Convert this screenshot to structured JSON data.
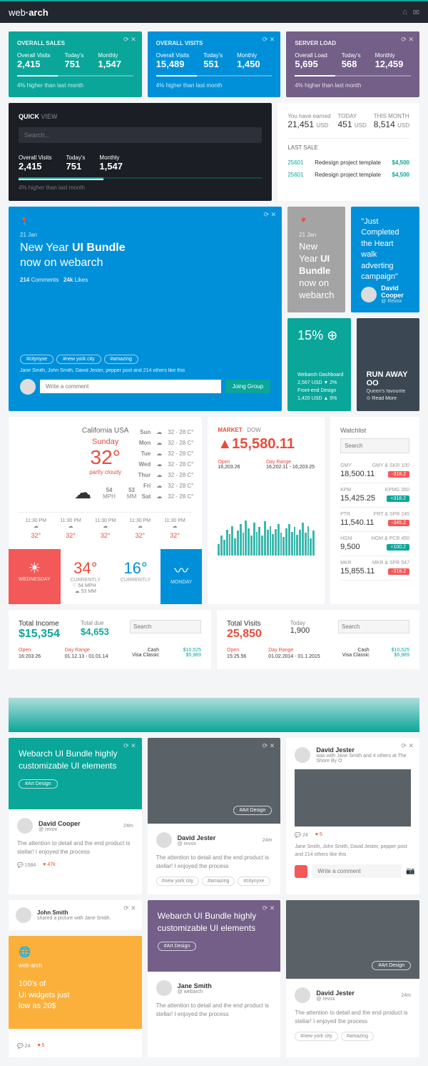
{
  "brand": {
    "pre": "web",
    "bold": "arch"
  },
  "stats": [
    {
      "title": "OVERALL SALES",
      "items": [
        {
          "l": "Overall Visits",
          "v": "2,415"
        },
        {
          "l": "Today's",
          "v": "751"
        },
        {
          "l": "Monthly",
          "v": "1,547"
        }
      ],
      "foot": "4% higher than last month"
    },
    {
      "title": "OVERALL VISITS",
      "items": [
        {
          "l": "Overall Visits",
          "v": "15,489"
        },
        {
          "l": "Today's",
          "v": "551"
        },
        {
          "l": "Monthly",
          "v": "1,450"
        }
      ],
      "foot": "4% higher than last month"
    },
    {
      "title": "SERVER LOAD",
      "items": [
        {
          "l": "Overall Load",
          "v": "5,695"
        },
        {
          "l": "Today's",
          "v": "568"
        },
        {
          "l": "Monthly",
          "v": "12,459"
        }
      ],
      "foot": "4% higher than last month"
    }
  ],
  "quickview": {
    "title": "QUICK",
    "title2": "VIEW",
    "placeholder": "Search...",
    "items": [
      {
        "l": "Overall Visits",
        "v": "2,415"
      },
      {
        "l": "Today's",
        "v": "751"
      },
      {
        "l": "Monthly",
        "v": "1,547"
      }
    ],
    "foot": "4% higher than last month"
  },
  "earnings": {
    "label": "You have earned",
    "value": "21,451",
    "unit": "USD",
    "today": {
      "l": "TODAY",
      "v": "451",
      "u": "USD"
    },
    "month": {
      "l": "THIS MONTH",
      "v": "8,514",
      "u": "USD"
    },
    "last": "LAST SALE",
    "sales": [
      {
        "id": "25601",
        "desc": "Redesign project template",
        "amt": "$4,500"
      },
      {
        "id": "25601",
        "desc": "Redesign project template",
        "amt": "$4,500"
      }
    ]
  },
  "bundle": {
    "date": "21 Jan",
    "line1": "New Year",
    "line2": "UI Bundle",
    "line3": "now on webarch",
    "comments": "214",
    "likes": "24k",
    "tags": [
      "#citynyxe",
      "#new york city",
      "#amazing"
    ],
    "foot": "Jane Smith, John Smith, David Jester, pepper post and 214 others like this",
    "commentPh": "Write a comment",
    "join": "Joing Group"
  },
  "quote": {
    "text": "\"Just Completed the Heart walk adverting campaign\"",
    "name": "David Cooper",
    "handle": "@ Revox"
  },
  "pct": {
    "val": "15%",
    "s1": "Webarch Dashboard",
    "s2": "2,567 USD   ▼ 2%",
    "s3": "Front-end Design",
    "s4": "1,420 USD   ▲ 5%"
  },
  "run": {
    "title": "RUN AWAY OO",
    "sub": "Queen's favourite",
    "more": "⊙ Read More"
  },
  "weather": {
    "loc": "California USA",
    "day": "Sunday",
    "temp": "32°",
    "cond": "partly cloudy",
    "mph": "54",
    "mm": "53",
    "hours": [
      {
        "t": "11:30 PM",
        "d": "32°"
      },
      {
        "t": "11:30 PM",
        "d": "32°"
      },
      {
        "t": "11:30 PM",
        "d": "32°"
      },
      {
        "t": "11:30 PM",
        "d": "32°"
      },
      {
        "t": "11:30 PM",
        "d": "32°"
      }
    ],
    "days": [
      {
        "d": "Sun",
        "r": "32 - 28 C°"
      },
      {
        "d": "Mon",
        "r": "32 - 28 C°"
      },
      {
        "d": "Tue",
        "r": "32 - 28 C°"
      },
      {
        "d": "Wed",
        "r": "32 - 28 C°"
      },
      {
        "d": "Thur",
        "r": "32 - 28 C°"
      },
      {
        "d": "Fri",
        "r": "32 - 28 C°"
      },
      {
        "d": "Sat",
        "r": "32 - 28 C°"
      }
    ]
  },
  "wtiles": [
    {
      "big": "",
      "lbl": "WEDNESDAY",
      "sm1": "54",
      "sm2": "53"
    },
    {
      "big": "34°",
      "lbl": "CURRENTLY",
      "sm1": "54",
      "sm2": "53"
    },
    {
      "big": "16°",
      "lbl": "CURRENTLY"
    },
    {
      "big": "",
      "lbl": "MONDAY"
    }
  ],
  "market": {
    "tab1": "MARKET",
    "tab2": "DOW",
    "val": "▲15,580.11",
    "open": "Open",
    "openv": "16,203.26",
    "range": "Day Range",
    "rangev": "16,202.11 - 16,203.25"
  },
  "watch": {
    "title": "Watchlist",
    "ph": "Search",
    "items": [
      {
        "sym": "GMY",
        "desc": "GMY & SKR 100",
        "price": "18,500.11",
        "badge": "-318.2",
        "cls": "red"
      },
      {
        "sym": "KPM",
        "desc": "KPMG 350",
        "price": "15,425.25",
        "badge": "+318.2",
        "cls": "green"
      },
      {
        "sym": "PTR",
        "desc": "PRT & SPR 245",
        "price": "11,540.11",
        "badge": "-345.2",
        "cls": "red"
      },
      {
        "sym": "HGM",
        "desc": "HGM & PCR 450",
        "price": "9,500",
        "badge": "+100.2",
        "cls": "green"
      },
      {
        "sym": "MKR",
        "desc": "MKR & SPR 547",
        "price": "15,855.11",
        "badge": "-318.2",
        "cls": "red"
      }
    ]
  },
  "income": {
    "title": "Total Income",
    "val": "$15,354",
    "due": "Total due",
    "duev": "$4,653",
    "ph": "Search",
    "open": "Open",
    "openv": "16:203.26",
    "range": "Day Range",
    "rangev": "01.12.13 - 01.01.14",
    "cash": "Cash",
    "cashv": "$10,525",
    "visa": "Visa Classic",
    "visav": "$5,989"
  },
  "visits": {
    "title": "Total Visits",
    "val": "25,850",
    "today": "Today",
    "todayv": "1,900",
    "ph": "Search",
    "open": "Open",
    "openv": "15:25.56",
    "range": "Day Range",
    "rangev": "01.02.2014 - 01.1.2015",
    "cash": "Cash",
    "cashv": "$10,525",
    "visa": "Visa Classic",
    "visav": "$5,989"
  },
  "social1": {
    "title": "Webarch UI Bundle highly customizable UI elements",
    "tag": "#Art Design",
    "name": "David Cooper",
    "handle": "@ revox",
    "time": "24m",
    "text": "The attention to detail and the end product is stellar! I enjoyed the process",
    "c": "1584",
    "h": "47k"
  },
  "social2": {
    "name": "David Jester",
    "handle": "@ revox",
    "time": "24m",
    "text": "The attention to detail and the end product is stellar! I enjoyed the process",
    "tags": [
      "#new york city",
      "#amazing",
      "#citynyxe"
    ]
  },
  "social3": {
    "name": "David Jester",
    "sub": "was with Jane Smith and 4 others at The Shore By O",
    "c": "24",
    "h": "5",
    "foot": "Jane Smith, John Smith, David Jester, pepper post and 214 others like this",
    "ph": "Write a comment"
  },
  "share": {
    "name": "John Smith",
    "sub": "shared a picture with Jane Smith."
  },
  "yellow": {
    "brand": "web·arch",
    "line1": "100's of",
    "line2": "UI widgets just",
    "line3": "low as 20$",
    "c": "24",
    "h": "5"
  },
  "social4": {
    "title": "Webarch UI Bundle highly customizable UI elements",
    "tag": "#Art Design",
    "name": "Jane Smith",
    "handle": "@ webarch",
    "text": "The attention to detail and the end product is stellar! I enjoyed the process"
  },
  "social5": {
    "name": "David Jester",
    "handle": "@ revox",
    "time": "24m",
    "text": "The attention to detail and the end product is stellar! I enjoyed the process",
    "tags": [
      "#new york city",
      "#amazing"
    ],
    "tag": "#Art Design"
  },
  "chart_data": {
    "type": "bar",
    "categories": [],
    "values": [
      20,
      35,
      28,
      45,
      38,
      52,
      30,
      44,
      55,
      40,
      62,
      48,
      35,
      58,
      42,
      50,
      36,
      60,
      45,
      52,
      38,
      47,
      55,
      40,
      33,
      48,
      56,
      42,
      50,
      37,
      45,
      58,
      40,
      52,
      30,
      44
    ],
    "ylim": [
      0,
      70
    ]
  }
}
